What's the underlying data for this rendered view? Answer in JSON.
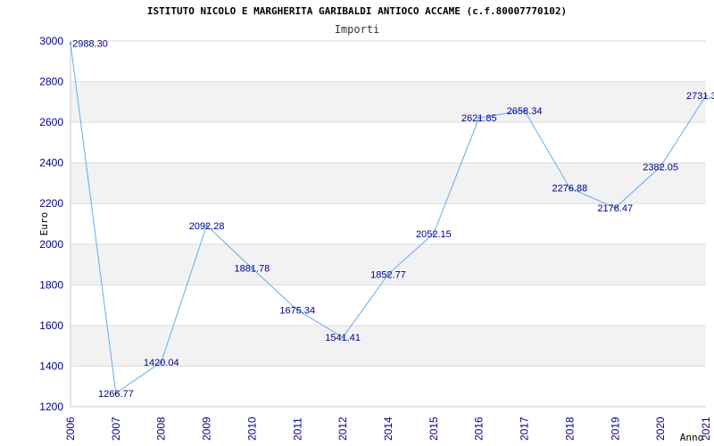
{
  "chart_data": {
    "type": "line",
    "title": "ISTITUTO NICOLO E MARGHERITA GARIBALDI ANTIOCO ACCAME (c.f.80007770102)",
    "subtitle": "Importi",
    "xlabel": "Anno",
    "ylabel": "Euro",
    "ylim": [
      1200,
      3000
    ],
    "yticks": [
      1200,
      1400,
      1600,
      1800,
      2000,
      2200,
      2400,
      2600,
      2800,
      3000
    ],
    "categories": [
      "2006",
      "2007",
      "2008",
      "2009",
      "2010",
      "2011",
      "2012",
      "2014",
      "2015",
      "2016",
      "2017",
      "2018",
      "2019",
      "2020",
      "2021"
    ],
    "values": [
      2988.3,
      1266.77,
      1420.04,
      2092.28,
      1881.78,
      1675.34,
      1541.41,
      1852.77,
      2052.15,
      2621.85,
      2658.34,
      2276.88,
      2178.47,
      2382.05,
      2731.3
    ],
    "labels": [
      "2988.30",
      "1266.77",
      "1420.04",
      "2092.28",
      "1881.78",
      "1675.34",
      "1541.41",
      "1852.77",
      "2052.15",
      "2621.85",
      "2658.34",
      "2276.88",
      "2178.47",
      "2382.05",
      "2731.3"
    ],
    "grid": true,
    "band_color": "#f2f2f2",
    "line_color": "#66aaee",
    "text_color": "#00008b"
  }
}
